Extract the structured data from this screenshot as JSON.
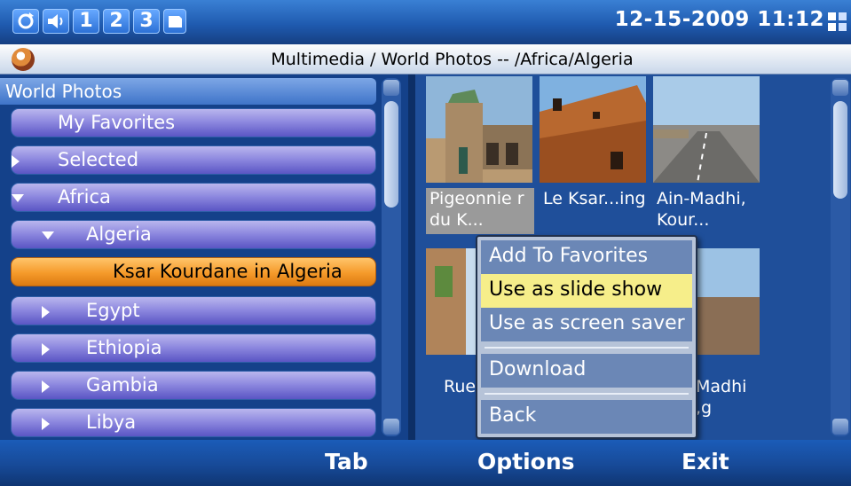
{
  "statusbar": {
    "icons": [
      "refresh-icon",
      "speaker-icon",
      "1",
      "2",
      "3",
      "card-icon"
    ],
    "line1": "1",
    "line2": "2",
    "line3": "3",
    "datetime": "12-15-2009 11:12"
  },
  "titlebar": {
    "title": "Multimedia / World Photos  --  /Africa/Algeria"
  },
  "tree": {
    "header": "World Photos",
    "items": [
      {
        "label": "My Favorites",
        "arrow": "none"
      },
      {
        "label": "Selected",
        "arrow": "right"
      },
      {
        "label": "Africa",
        "arrow": "down"
      },
      {
        "label": "Algeria",
        "arrow": "down"
      },
      {
        "label": "Ksar Kourdane in Algeria",
        "arrow": "none",
        "selected": true
      },
      {
        "label": "Egypt",
        "arrow": "right"
      },
      {
        "label": "Ethiopia",
        "arrow": "right"
      },
      {
        "label": "Gambia",
        "arrow": "right"
      },
      {
        "label": "Libya",
        "arrow": "right"
      }
    ]
  },
  "photos": {
    "captions": [
      "Pigeonnie r du K...",
      "Le Ksar...ing",
      "Ain-Madhi, Kour...",
      "Rue Ain",
      "Madhi ,g"
    ]
  },
  "context_menu": {
    "items": [
      "Add To Favorites",
      "Use as slide show",
      "Use as screen saver",
      "Download",
      "Back"
    ],
    "active": "Use as slide show"
  },
  "softkeys": {
    "left": "Tab",
    "center": "Options",
    "right": "Exit"
  },
  "colors": {
    "status_bar": "#1f5bb0",
    "selected_item": "#f59a2a",
    "menu_active": "#f6ee8a",
    "tree_item": "#8f8ae0"
  }
}
